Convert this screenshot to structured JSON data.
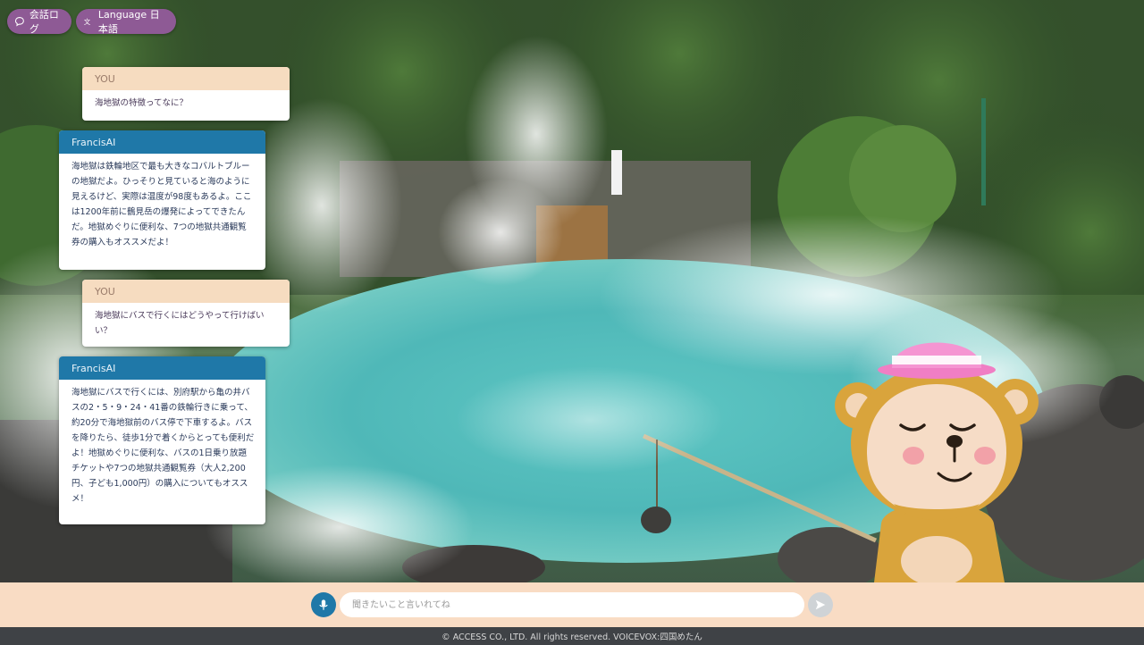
{
  "header": {
    "history_label": "会話ログ",
    "language_label": "Language 日本語"
  },
  "chat": {
    "messages": [
      {
        "speaker": "YOU",
        "text": "海地獄の特徴ってなに？"
      },
      {
        "speaker": "FrancisAI",
        "text": "海地獄は鉄輪地区で最も大きなコバルトブルーの地獄だよ。ひっそりと見ていると海のように見えるけど、実際は温度が98度もあるよ。ここは1200年前に鶴見岳の爆発によってできたんだ。地獄めぐりに便利な、7つの地獄共通観覧券の購入もオススメだよ！"
      },
      {
        "speaker": "YOU",
        "text": "海地獄にバスで行くにはどうやって行けばいい？"
      },
      {
        "speaker": "FrancisAI",
        "text": "海地獄にバスで行くには、別府駅から亀の井バスの2・5・9・24・41番の鉄輪行きに乗って、約20分で海地獄前のバス停で下車するよ。バスを降りたら、徒歩1分で着くからとっても便利だよ！地獄めぐりに便利な、バスの1日乗り放題チケットや7つの地獄共通観覧券（大人2,200円、子ども1,000円）の購入についてもオススメ！"
      }
    ]
  },
  "input": {
    "placeholder": "聞きたいこと言いれてね"
  },
  "footer": {
    "copyright": "© ACCESS CO., LTD. All rights reserved. VOICEVOX:四国めたん"
  },
  "colors": {
    "pill": "#8e5a95",
    "you_header": "#f6dcc0",
    "ai_header": "#1f78a8",
    "input_bar": "#f9dcc4",
    "footer": "#3f4246"
  },
  "icons": {
    "history": "chat-bubble-icon",
    "language": "translate-icon",
    "mic": "microphone-icon",
    "send": "send-arrow-icon"
  }
}
